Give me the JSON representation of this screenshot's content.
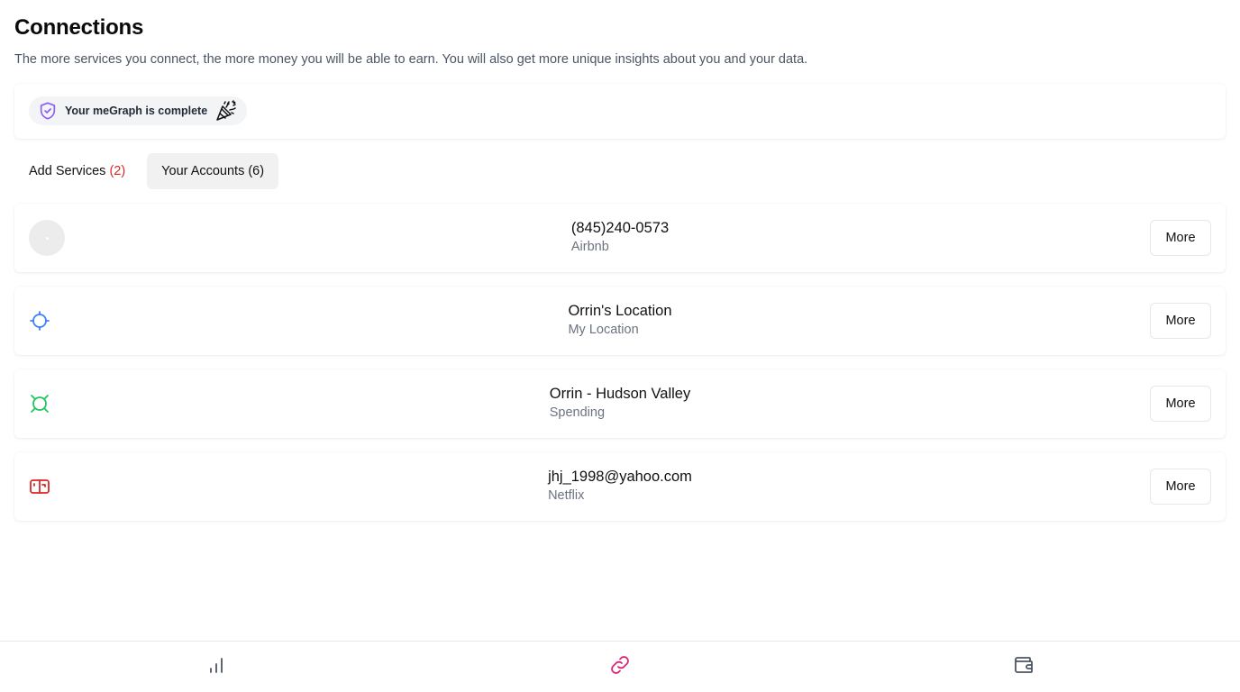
{
  "header": {
    "title": "Connections",
    "subtitle": "The more services you connect, the more money you will be able to earn. You will also get more unique insights about you and your data."
  },
  "status": {
    "text": "Your meGraph is complete",
    "shield_icon": "shield-check-icon",
    "celebrate_icon": "party-popper-icon",
    "accent": "#8b5cf6"
  },
  "tabs": [
    {
      "label": "Add Services",
      "count": "(2)",
      "count_color": "#dc2626"
    },
    {
      "label": "Your Accounts",
      "count": "(6)"
    }
  ],
  "accounts": [
    {
      "name": "(845)240-0573",
      "service": "Airbnb",
      "icon": "avatar-placeholder",
      "more_label": "More"
    },
    {
      "name": "Orrin's Location",
      "service": "My Location",
      "icon": "crosshair-icon",
      "icon_color": "#3b82f6",
      "more_label": "More"
    },
    {
      "name": "Orrin - Hudson Valley",
      "service": "Spending",
      "icon": "currency-icon",
      "icon_color": "#22c55e",
      "more_label": "More"
    },
    {
      "name": "jhj_1998@yahoo.com",
      "service": "Netflix",
      "icon": "ticket-icon",
      "icon_color": "#dc2626",
      "more_label": "More"
    }
  ],
  "bottom_nav": [
    {
      "icon": "bar-chart-icon",
      "color": "#4b5563"
    },
    {
      "icon": "link-icon",
      "color": "#db2777",
      "active": true
    },
    {
      "icon": "wallet-icon",
      "color": "#4b5563"
    }
  ]
}
